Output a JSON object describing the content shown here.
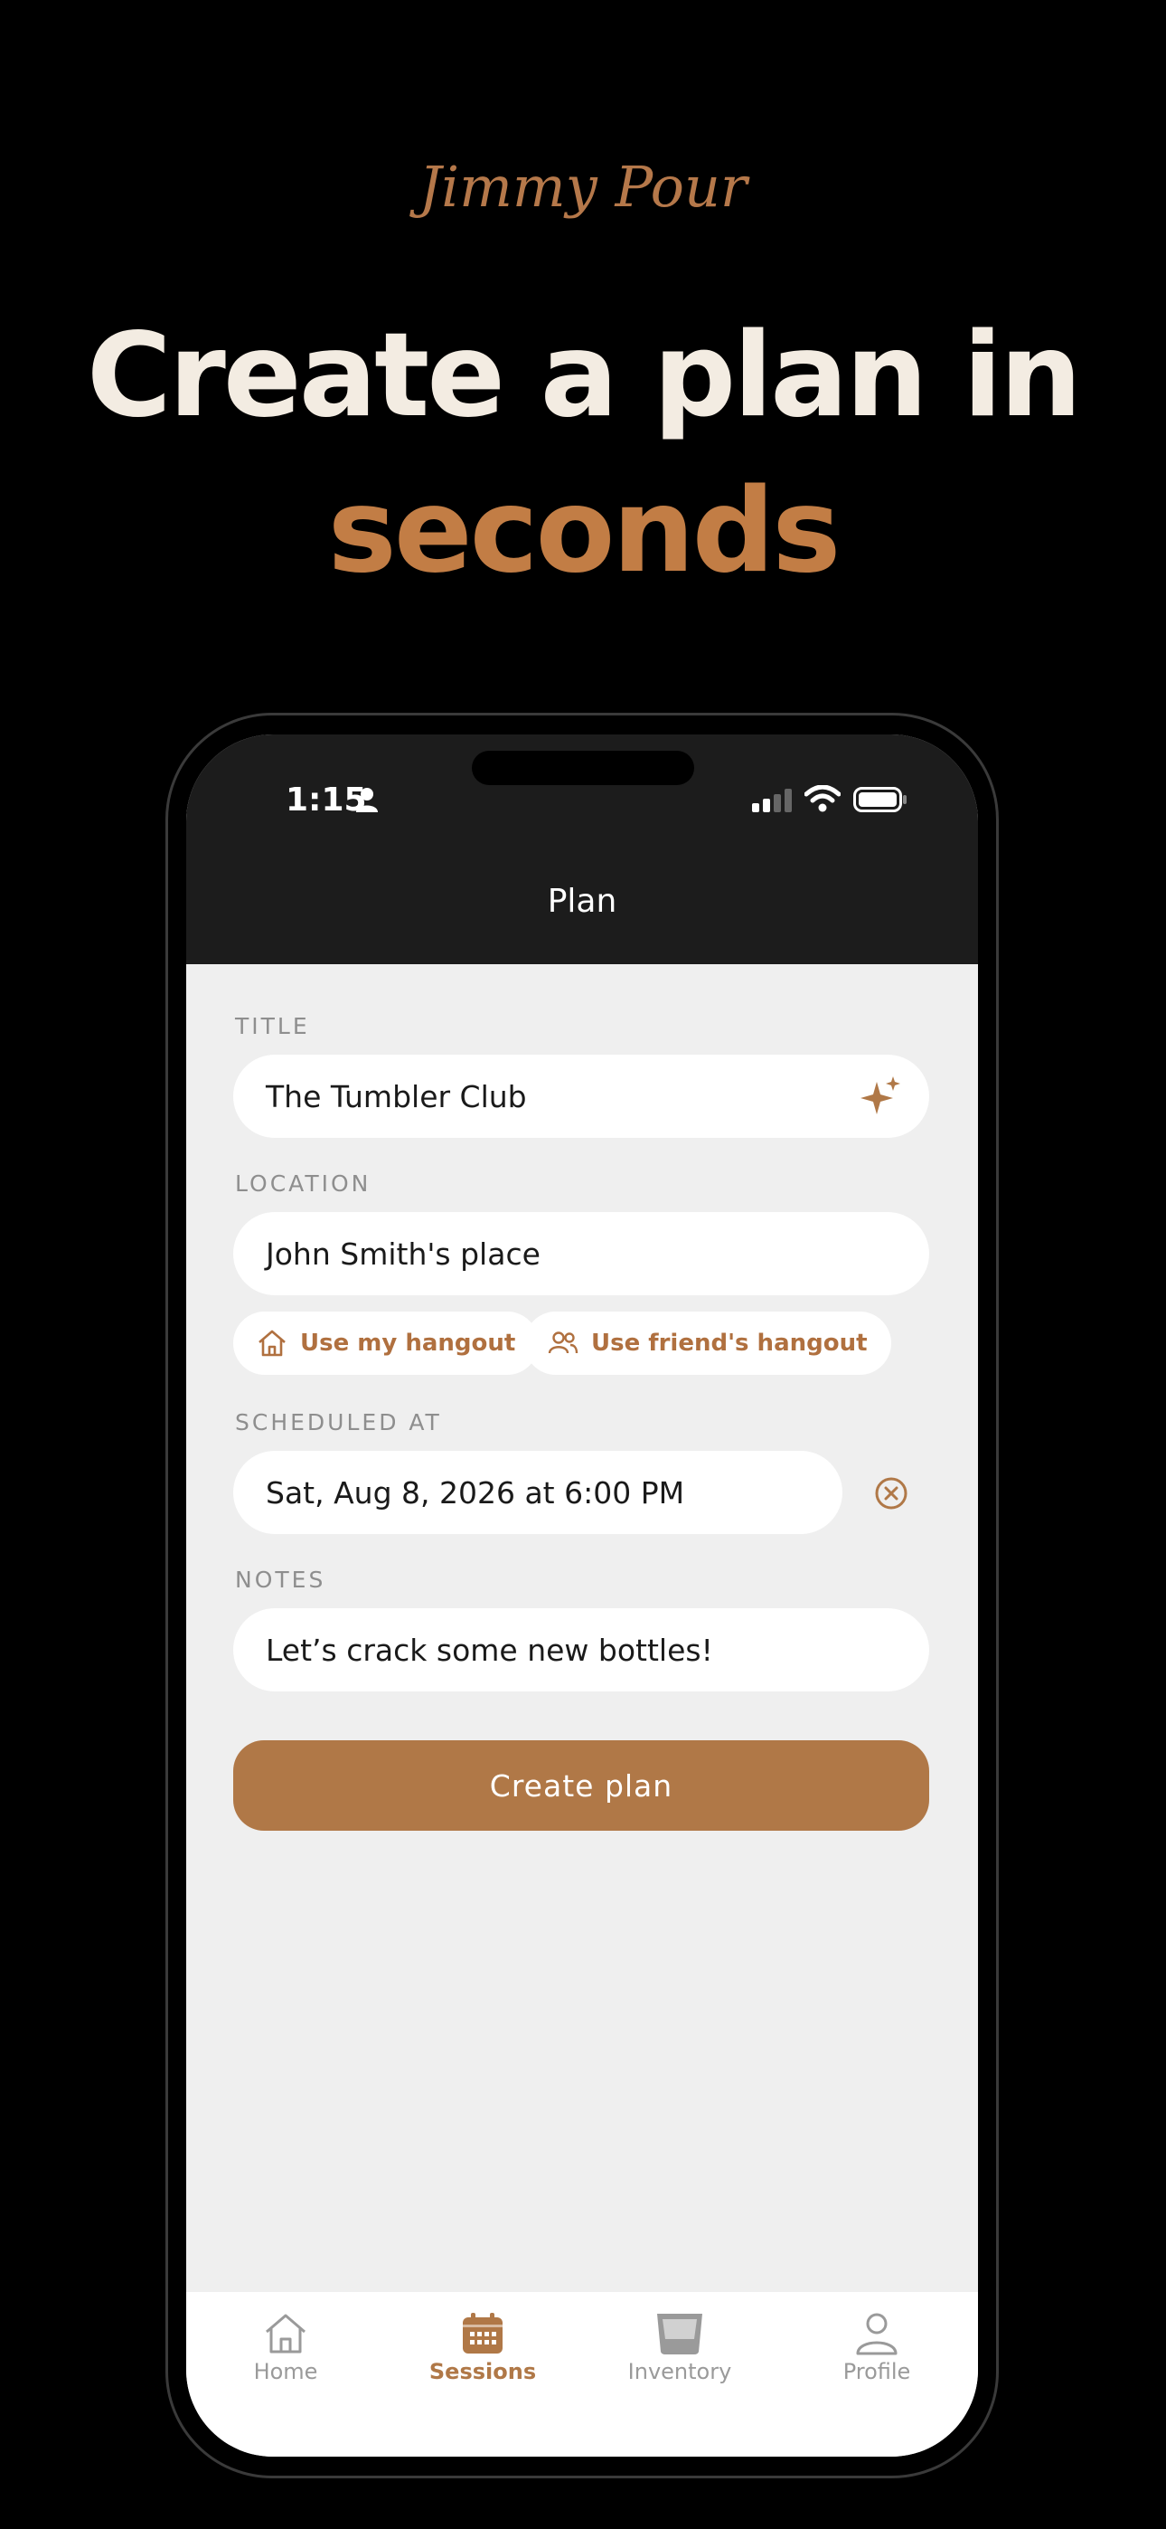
{
  "brand": "Jimmy Pour",
  "headline": {
    "line1": "Create a plan in",
    "line2": "seconds"
  },
  "status_bar": {
    "time": "1:15"
  },
  "nav": {
    "title": "Plan"
  },
  "form": {
    "title_label": "TITLE",
    "title_value": "The Tumbler Club",
    "location_label": "LOCATION",
    "location_value": "John Smith's place",
    "chip_my_hangout": "Use my hangout",
    "chip_friend_hangout": "Use friend's hangout",
    "scheduled_label": "SCHEDULED AT",
    "scheduled_value": "Sat, Aug 8, 2026 at 6:00 PM",
    "notes_label": "NOTES",
    "notes_value": "Let’s crack some new bottles!",
    "submit_label": "Create plan"
  },
  "tabs": [
    {
      "label": "Home",
      "icon": "home-icon",
      "active": false
    },
    {
      "label": "Sessions",
      "icon": "calendar-icon",
      "active": true
    },
    {
      "label": "Inventory",
      "icon": "glass-icon",
      "active": false
    },
    {
      "label": "Profile",
      "icon": "person-icon",
      "active": false
    }
  ],
  "colors": {
    "accent": "#b07847",
    "headline_light": "#f3ece2",
    "headline_accent": "#c27d45",
    "background": "#000000"
  }
}
